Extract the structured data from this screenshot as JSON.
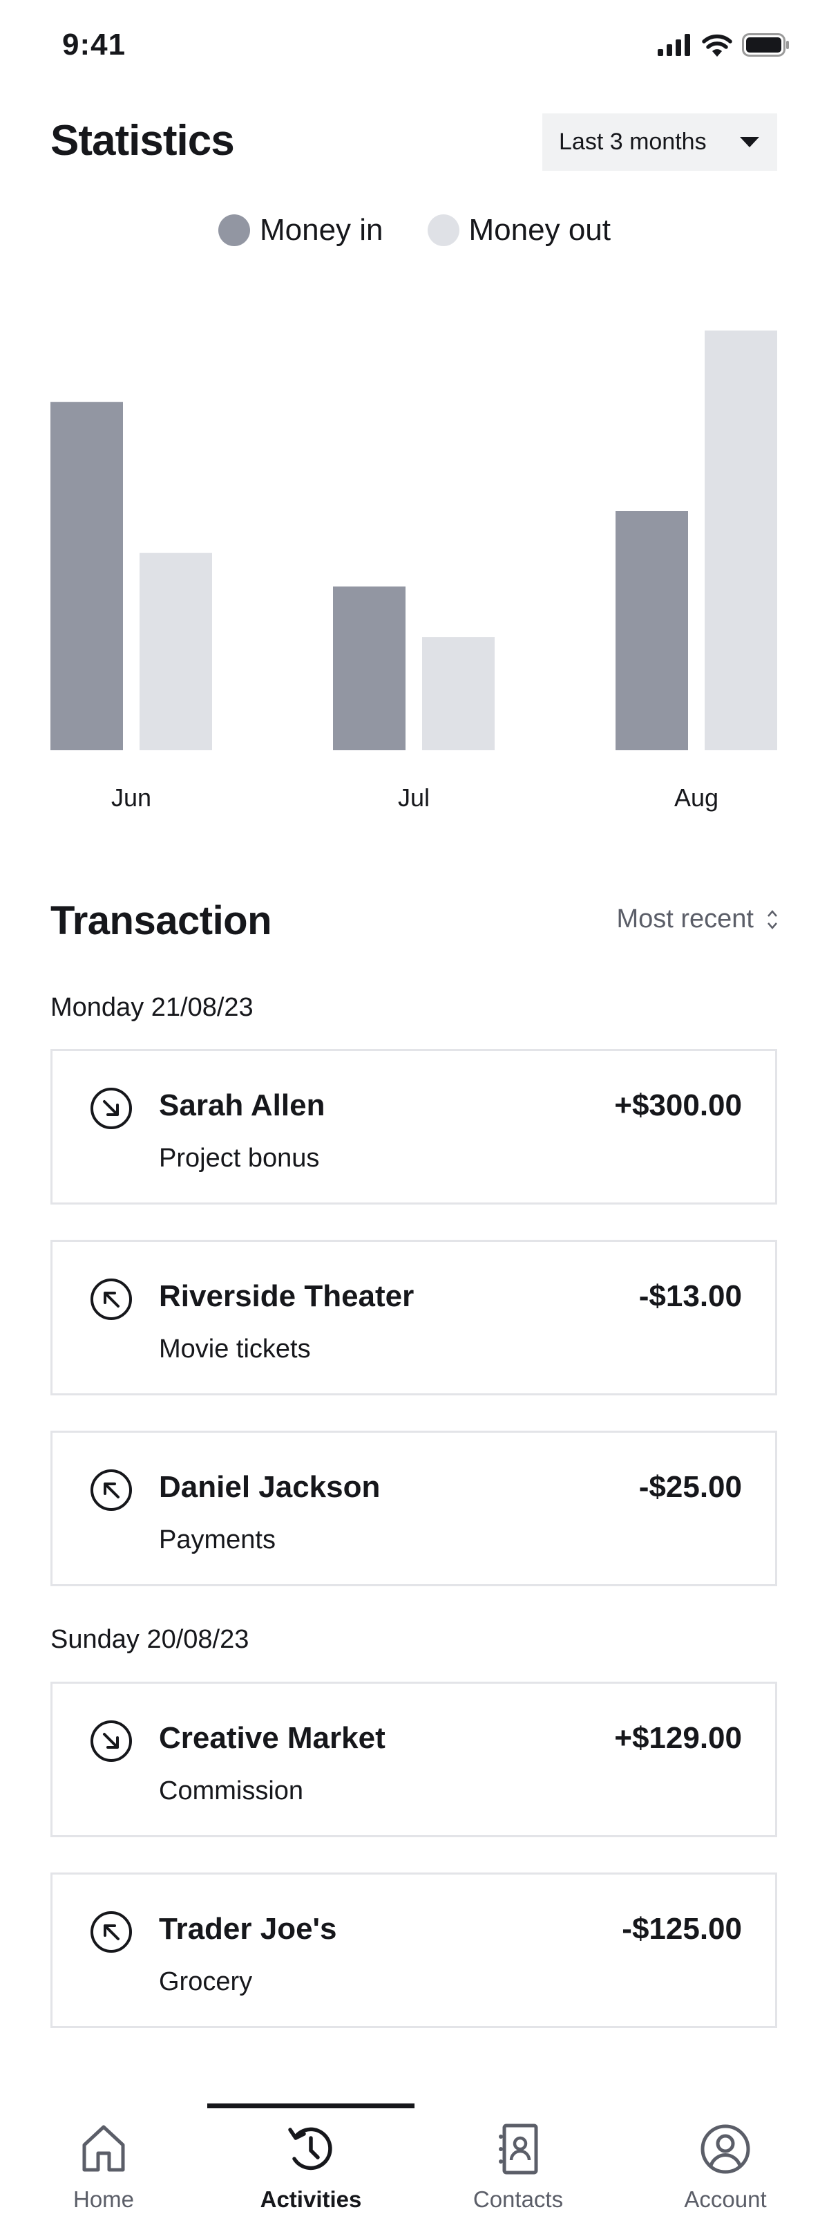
{
  "status_bar": {
    "time": "9:41",
    "icons": [
      "signal-icon",
      "wifi-icon",
      "battery-icon"
    ]
  },
  "statistics": {
    "title": "Statistics",
    "period_dropdown": {
      "selected": "Last 3 months",
      "icon": "caret-down-icon"
    }
  },
  "colors": {
    "money_in": "#9296a2",
    "money_out": "#dfe1e6",
    "text_primary": "#16171b",
    "text_secondary": "#5b5e68",
    "card_border": "#e3e4e8"
  },
  "chart_data": {
    "type": "bar",
    "title": "",
    "xlabel": "",
    "ylabel": "",
    "categories": [
      "Jun",
      "Jul",
      "Aug"
    ],
    "series": [
      {
        "name": "Money in",
        "values": [
          83,
          39,
          57
        ]
      },
      {
        "name": "Money out",
        "values": [
          47,
          27,
          100
        ]
      }
    ],
    "ylim": [
      0,
      100
    ],
    "grid": false,
    "legend": "top-center",
    "y_axis_visible": false
  },
  "transactions": {
    "title": "Transaction",
    "sort": {
      "label": "Most recent",
      "icon": "sort-updown-icon"
    },
    "groups": [
      {
        "date": "Monday 21/08/23",
        "items": [
          {
            "name": "Sarah Allen",
            "description": "Project bonus",
            "amount": "+$300.00",
            "direction": "in",
            "icon": "arrow-down-right-circle-icon"
          },
          {
            "name": "Riverside Theater",
            "description": "Movie tickets",
            "amount": "-$13.00",
            "direction": "out",
            "icon": "arrow-up-left-circle-icon"
          },
          {
            "name": "Daniel Jackson",
            "description": "Payments",
            "amount": "-$25.00",
            "direction": "out",
            "icon": "arrow-up-left-circle-icon"
          }
        ]
      },
      {
        "date": "Sunday 20/08/23",
        "items": [
          {
            "name": "Creative Market",
            "description": "Commission",
            "amount": "+$129.00",
            "direction": "in",
            "icon": "arrow-down-right-circle-icon"
          },
          {
            "name": "Trader Joe's",
            "description": "Grocery",
            "amount": "-$125.00",
            "direction": "out",
            "icon": "arrow-up-left-circle-icon"
          }
        ]
      }
    ]
  },
  "bottom_nav": {
    "active_index": 1,
    "items": [
      {
        "label": "Home",
        "icon": "home-icon"
      },
      {
        "label": "Activities",
        "icon": "history-icon"
      },
      {
        "label": "Contacts",
        "icon": "contact-book-icon"
      },
      {
        "label": "Account",
        "icon": "account-circle-icon"
      }
    ]
  }
}
